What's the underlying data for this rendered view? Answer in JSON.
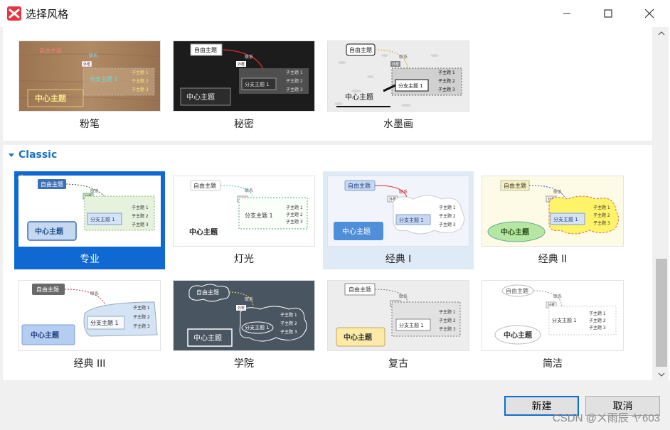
{
  "window": {
    "title": "选择风格"
  },
  "top_row": [
    {
      "label": "粉笔"
    },
    {
      "label": "秘密"
    },
    {
      "label": "水墨画"
    }
  ],
  "section": {
    "title": "Classic"
  },
  "classic_row1": [
    {
      "label": "专业",
      "selected": true
    },
    {
      "label": "灯光"
    },
    {
      "label": "经典 I",
      "hover": true
    },
    {
      "label": "经典 II"
    }
  ],
  "classic_row2": [
    {
      "label": "经典 III"
    },
    {
      "label": "学院"
    },
    {
      "label": "复古"
    },
    {
      "label": "简洁"
    }
  ],
  "thumb_text": {
    "central": "中心主题",
    "free": "自由主题",
    "relation": "联系",
    "outline": "外框",
    "main": "分支主题 1",
    "sub1": "子主题 1",
    "sub2": "子主题 2",
    "sub3": "子主题 3"
  },
  "footer": {
    "new_label": "新建",
    "cancel_label": "取消"
  },
  "watermark": "CSDN @ㄨ雨辰 ヤ603",
  "colors": {
    "accent": "#1068d3",
    "logo": "#e8333e",
    "section_title": "#1d72c4"
  }
}
